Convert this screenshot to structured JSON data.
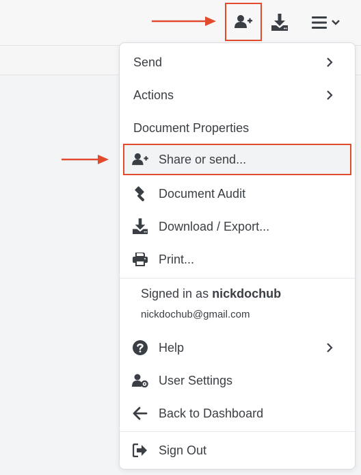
{
  "toolbar": {
    "share_icon": "user-plus-icon",
    "download_icon": "download-icon",
    "menu_icon": "hamburger-icon",
    "menu_chevron_icon": "chevron-down-icon"
  },
  "annotation": {
    "arrow_color": "#e24a2d",
    "highlight_color": "#e24a2d"
  },
  "menu": {
    "items": [
      {
        "label": "Send",
        "has_submenu": true
      },
      {
        "label": "Actions",
        "has_submenu": true
      },
      {
        "label": "Document Properties",
        "has_submenu": false
      },
      {
        "label": "Share or send...",
        "icon": "user-plus-icon",
        "highlighted": true
      },
      {
        "label": "Document Audit",
        "icon": "gavel-icon"
      },
      {
        "label": "Download / Export...",
        "icon": "download-icon"
      },
      {
        "label": "Print...",
        "icon": "printer-icon"
      }
    ],
    "account": {
      "signed_in_prefix": "Signed in as ",
      "username": "nickdochub",
      "email": "nickdochub@gmail.com"
    },
    "items2": [
      {
        "label": "Help",
        "icon": "question-circle-icon",
        "has_submenu": true
      },
      {
        "label": "User Settings",
        "icon": "user-gear-icon"
      },
      {
        "label": "Back to Dashboard",
        "icon": "arrow-left-icon"
      }
    ],
    "signout": {
      "label": "Sign Out",
      "icon": "sign-out-icon"
    }
  }
}
